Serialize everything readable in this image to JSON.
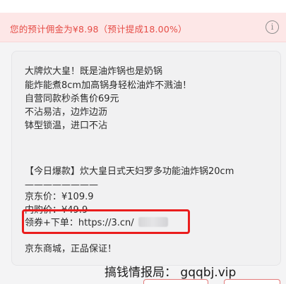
{
  "commission": {
    "text": "您的预计佣金为¥8.98（预计提成18.00%）",
    "info_icon": "info-icon",
    "colors": {
      "background": "#fde7e7",
      "text": "#e64d47"
    }
  },
  "copy": {
    "lines": [
      "大牌炊大皇！既是油炸锅也是奶锅",
      "能炸能煮8cm加高锅身轻松油炸不溅油！",
      "自营同款秒杀售价69元",
      "不沾易洁，边炸边沥",
      "钵型锁温，进口不沾",
      "【今日爆款】炊大皇日式天妇罗多功能油炸锅20cm",
      "————————",
      "京东价：¥109.9",
      "内购价：¥49.9",
      "领券+下单：https://3.cn/",
      "京东商城，正品保证！"
    ]
  },
  "watermark": {
    "text": "搞钱情报局： gqqbj.vip"
  },
  "accent": {
    "highlight_border": "#ea1d1d"
  }
}
